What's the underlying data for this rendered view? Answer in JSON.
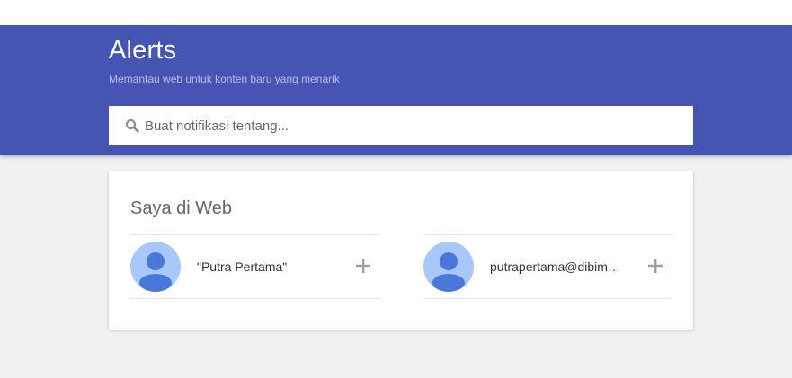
{
  "header": {
    "title": "Alerts",
    "subtitle": "Memantau web untuk konten baru yang menarik"
  },
  "search": {
    "placeholder": "Buat notifikasi tentang...",
    "icon": "search-icon"
  },
  "me_on_web": {
    "title": "Saya di Web",
    "items": [
      {
        "label": "\"Putra Pertama\"",
        "icon": "plus-icon"
      },
      {
        "label": "putrapertama@dibimbing.id",
        "icon": "plus-icon"
      }
    ]
  },
  "colors": {
    "header_bg": "#4654b4",
    "avatar_bg": "#a8c7fa",
    "avatar_fg": "#4a78d8",
    "page_bg": "#f1f1f1"
  }
}
